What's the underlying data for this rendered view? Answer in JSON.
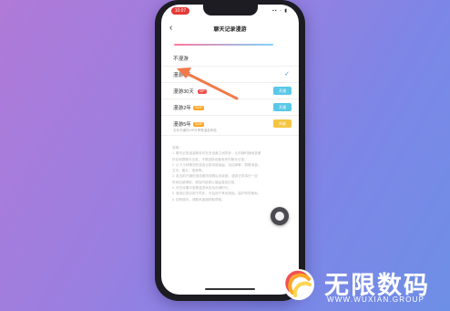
{
  "status_bar": {
    "time": "10:07",
    "icons": "▪▪ ◦ ▮"
  },
  "nav": {
    "back_icon": "back-arrow-icon",
    "title": "聊天记录漫游"
  },
  "options": [
    {
      "label": "不漫游",
      "selected": false
    },
    {
      "label": "漫游7天",
      "selected": true,
      "check": "✓"
    },
    {
      "label": "漫游30天",
      "tag": "VIP",
      "tag_color": "#ef5350",
      "action": "开通",
      "action_color": "#5bc8e8"
    },
    {
      "label": "漫游2年",
      "tag": "SVIP",
      "tag_color": "#ffa726",
      "action": "开通",
      "action_color": "#5bc8e8"
    },
    {
      "label": "漫游5年",
      "tag": "SVIP",
      "tag_color": "#ffa726",
      "action": "升级",
      "action_color": "#f5c542",
      "sub": "去年开通内VIP可享受漫游体验"
    }
  ],
  "notes": [
    "说明：",
    "1. 聊天记录漫游服务可在多设备之间同步，让你随时随地查看",
    "   好友和群聊天记录，不再因换设备而丢失聊天记录。",
    "2. 以下几种情况的漫游记录将被保留，包括单聊、群聊消息；",
    "   文字、图片、语音等。",
    "3. 若当前开通的漫游服务到期后未续费，漫游记录将在一定",
    "   时间后被清除，请及时续费以保留漫游记录。",
    "4. 可在设置中查看漫游状态及存储时长。",
    "5. 漫游记录仅用于同步，不会用于其他用途，保护你的隐私。",
    "6. 如有疑问，请联系客服获取帮助。"
  ],
  "brand": {
    "name": "无限数码",
    "url": "WWW.WUXIAN.GROUP"
  },
  "colors": {
    "accent": "#2e9bf0",
    "arrow": "#f07a4a",
    "background_start": "#b07ad8",
    "background_end": "#6e8fe6"
  }
}
